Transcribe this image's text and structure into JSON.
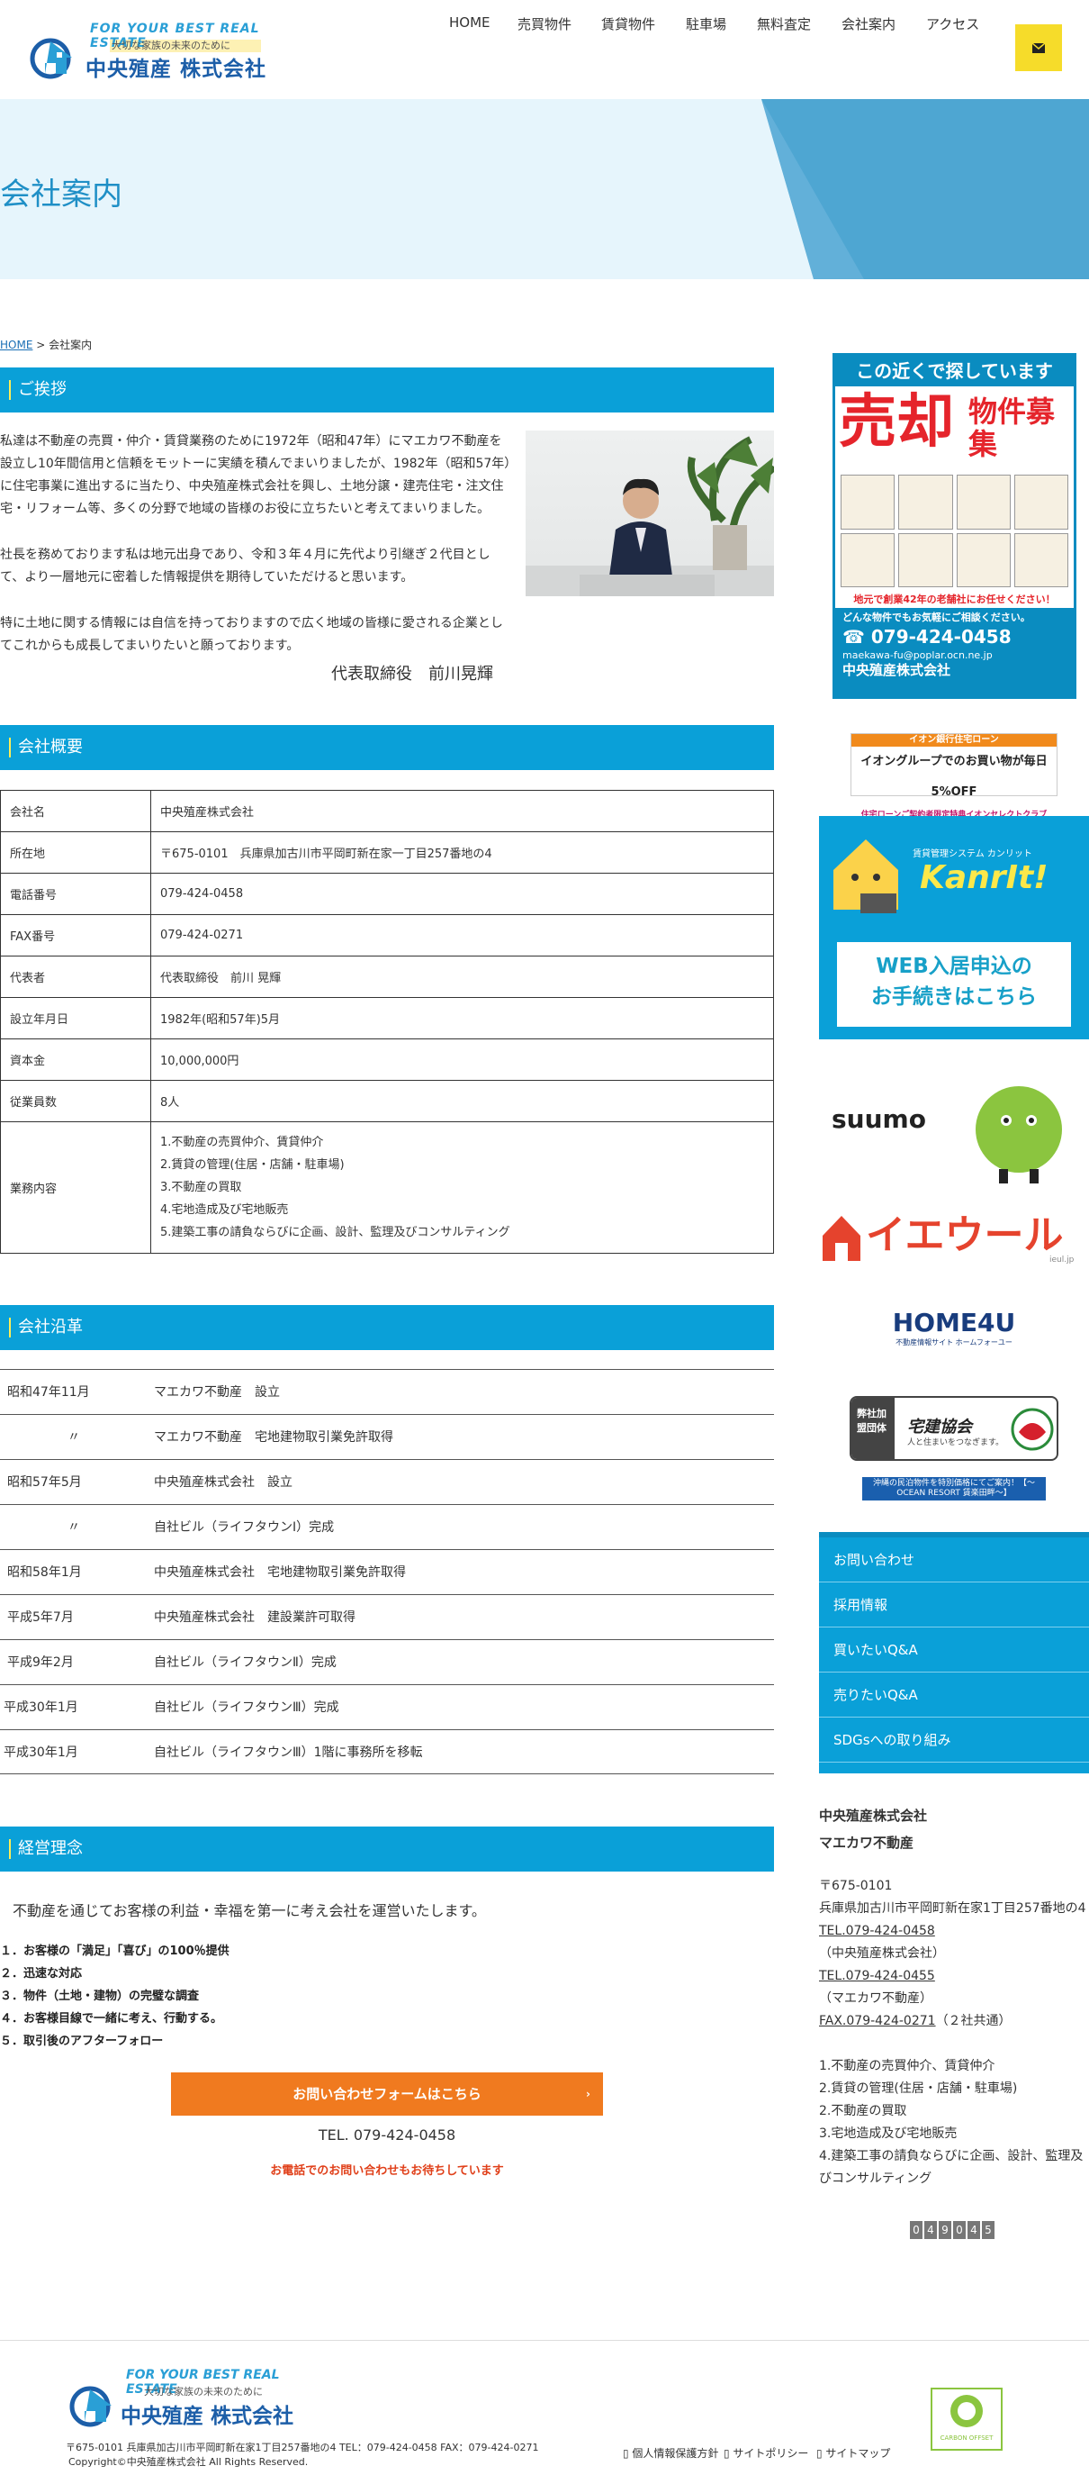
{
  "header": {
    "logo_tagline": "FOR YOUR BEST REAL ESTATE",
    "logo_sub": "大切な家族の未来のために",
    "logo_name": "中央殖産 株式会社",
    "nav": [
      "HOME",
      "売買物件",
      "賃貸物件",
      "駐車場",
      "無料査定",
      "会社案内",
      "アクセス"
    ]
  },
  "hero": {
    "title": "会社案内"
  },
  "breadcrumb": {
    "home": "HOME",
    "sep": " > ",
    "current": "会社案内"
  },
  "greeting": {
    "heading": "ご挨拶",
    "p1": "私達は不動産の売買・仲介・賃貸業務のために1972年（昭和47年）にマエカワ不動産を設立し10年間信用と信頼をモットーに実績を積んでまいりましたが、1982年（昭和57年）に住宅事業に進出するに当たり、中央殖産株式会社を興し、土地分譲・建売住宅・注文住宅・リフォーム等、多くの分野で地域の皆様のお役に立ちたいと考えてまいりました。",
    "p2": "社長を務めております私は地元出身であり、令和３年４月に先代より引継ぎ２代目として、より一層地元に密着した情報提供を期待していただけると思います。",
    "p3": "特に土地に関する情報には自信を持っておりますので広く地域の皆様に愛される企業としてこれからも成長してまいりたいと願っております。",
    "signature": "代表取締役　前川晃輝"
  },
  "overview": {
    "heading": "会社概要",
    "rows": [
      {
        "k": "会社名",
        "v": "中央殖産株式会社"
      },
      {
        "k": "所在地",
        "v": "〒675-0101　兵庫県加古川市平岡町新在家一丁目257番地の4"
      },
      {
        "k": "電話番号",
        "v": "079-424-0458"
      },
      {
        "k": "FAX番号",
        "v": "079-424-0271"
      },
      {
        "k": "代表者",
        "v": "代表取締役　前川 晃輝"
      },
      {
        "k": "設立年月日",
        "v": "1982年(昭和57年)5月"
      },
      {
        "k": "資本金",
        "v": "10,000,000円"
      },
      {
        "k": "従業員数",
        "v": "8人"
      }
    ],
    "business_label": "業務内容",
    "business": [
      "1.不動産の売買仲介、賃貸仲介",
      "2.賃貸の管理(住居・店舗・駐車場)",
      "3.不動産の買取",
      "4.宅地造成及び宅地販売",
      "5.建築工事の請負ならびに企画、設計、監理及びコンサルティング"
    ]
  },
  "history": {
    "heading": "会社沿革",
    "rows": [
      {
        "d": "昭和47年11月",
        "t": "マエカワ不動産　設立"
      },
      {
        "d": "〃",
        "t": "マエカワ不動産　宅地建物取引業免許取得"
      },
      {
        "d": "昭和57年5月",
        "t": "中央殖産株式会社　設立"
      },
      {
        "d": "〃",
        "t": "自社ビル（ライフタウンⅠ）完成"
      },
      {
        "d": "昭和58年1月",
        "t": "中央殖産株式会社　宅地建物取引業免許取得"
      },
      {
        "d": "平成5年7月",
        "t": "中央殖産株式会社　建設業許可取得"
      },
      {
        "d": "平成9年2月",
        "t": "自社ビル（ライフタウンⅡ）完成"
      },
      {
        "d": "平成30年1月",
        "t": "自社ビル（ライフタウンⅢ）完成"
      },
      {
        "d": "平成30年1月",
        "t": "自社ビル（ライフタウンⅢ）1階に事務所を移転"
      }
    ]
  },
  "philosophy": {
    "heading": "経営理念",
    "lead": "不動産を通じてお客様の利益・幸福を第一に考え会社を運営いたします。",
    "items": [
      "１．お客様の「満足」「喜び」の100％提供",
      "２．迅速な対応",
      "３．物件（土地・建物）の完璧な調査",
      "４．お客様目線で一緒に考え、行動する。",
      "５．取引後のアフターフォロー"
    ],
    "cta": "お問い合わせフォームはこちら",
    "tel": "TEL. 079-424-0458",
    "tel_note": "お電話でのお問い合わせもお待ちしています"
  },
  "sidebar": {
    "banner1": {
      "title": "この近くで探しています",
      "big": "売却",
      "big2": "物件募集",
      "line": "地元で創業42年の老舗社にお任せください！",
      "line2": "どんな物件でもお気軽にご相談ください。",
      "phone": "079-424-0458",
      "email": "maekawa-fu@poplar.ocn.ne.jp",
      "company": "中央殖産株式会社"
    },
    "aeon": {
      "top": "イオン銀行住宅ローン",
      "main": "イオングループでのお買い物が毎日5%OFF",
      "sub": "住宅ローンご契約者限定特典イオンセレクトクラブ"
    },
    "kanrit": {
      "small": "賃貸管理システム カンリット",
      "logo": "KanrIt!",
      "text1": "WEB入居申込の",
      "text2": "お手続きはこちら"
    },
    "suumo": "suumo",
    "ieul": "イエウール",
    "ieul_small": "ieul.jp",
    "home4u": "HOME4U",
    "home4u_sub": "不動産情報サイト ホームフォーユー",
    "takken": {
      "left": "弊社加盟団体",
      "title": "宅建協会",
      "sub": "人と住まいをつなぎます。"
    },
    "ocean": "沖縄の民泊物件を特別価格にてご案内！【～OCEAN RESORT 賃楽田畔～】",
    "menu": [
      "お問い合わせ",
      "採用情報",
      "買いたいQ&A",
      "売りたいQ&A",
      "SDGsへの取り組み"
    ],
    "info": {
      "name1": "中央殖産株式会社",
      "name2": "マエカワ不動産",
      "zip": "〒675-0101",
      "addr": "兵庫県加古川市平岡町新在家1丁目257番地の4",
      "tel1": "TEL.079-424-0458",
      "tel1_note": "（中央殖産株式会社）",
      "tel2": "TEL.079-424-0455",
      "tel2_note": "（マエカワ不動産）",
      "fax": "FAX.079-424-0271",
      "fax_note": "（２社共通）",
      "biz": [
        "1.不動産の売買仲介、賃貸仲介",
        "2.賃貸の管理(住居・店舗・駐車場)",
        "2.不動産の買取",
        "3.宅地造成及び宅地販売",
        "4.建築工事の請負ならびに企画、設計、監理及びコンサルティング"
      ],
      "counter": [
        "0",
        "4",
        "9",
        "0",
        "4",
        "5"
      ]
    }
  },
  "footer": {
    "address": "〒675-0101 兵庫県加古川市平岡町新在家1丁目257番地の4 TEL：079-424-0458  FAX：079-424-0271",
    "copyright": "Copyright©中央殖産株式会社 All Rights Reserved.",
    "links": [
      "個人情報保護方針",
      "サイトポリシー",
      "サイトマップ"
    ],
    "badge": "CARBON OFFSET"
  },
  "colors": {
    "accent": "#0aa0d8",
    "cta": "#f07a1f",
    "mail_button": "#f6dc2a",
    "hero_bg": "#e6f5fc"
  }
}
